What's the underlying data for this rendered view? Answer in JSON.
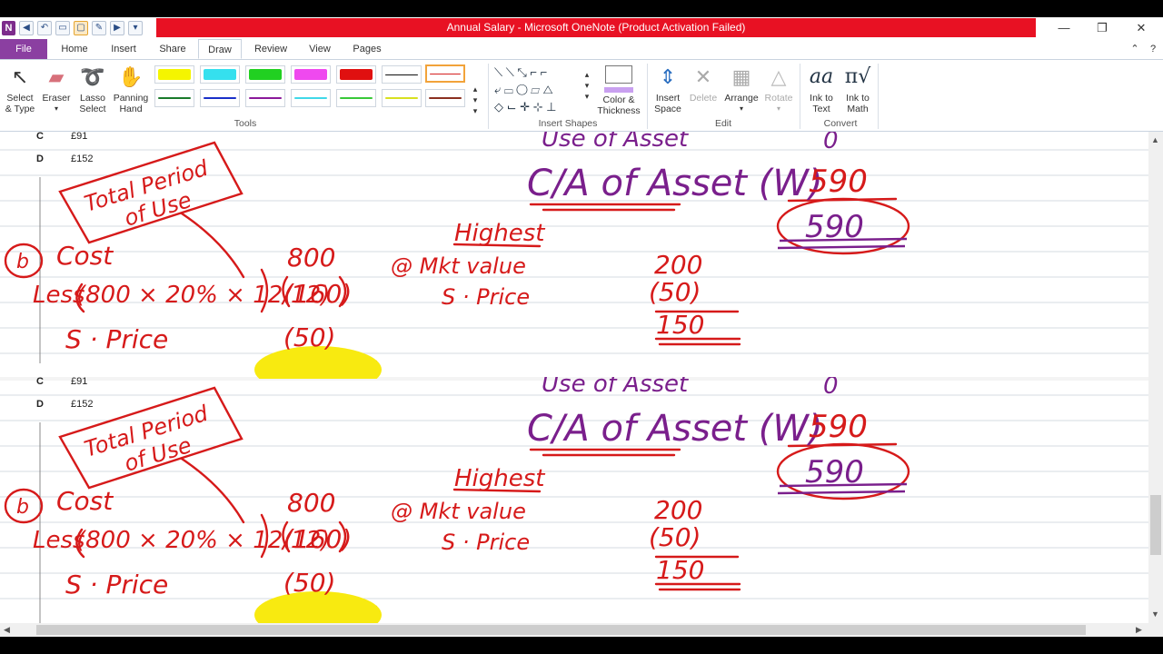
{
  "window": {
    "title": "Annual Salary - Microsoft OneNote (Product Activation Failed)",
    "app_icon": "N",
    "controls": [
      "minimize-icon",
      "restore-icon",
      "close-icon"
    ]
  },
  "tabs": [
    "File",
    "Home",
    "Insert",
    "Share",
    "Draw",
    "Review",
    "View",
    "Pages"
  ],
  "active_tab": "Draw",
  "ribbon": {
    "select_type": "Select\n& Type",
    "eraser": "Eraser",
    "lasso_select": "Lasso\nSelect",
    "panning_hand": "Panning\nHand",
    "tools_label": "Tools",
    "insert_shapes_label": "Insert Shapes",
    "color_thickness": "Color &\nThickness",
    "insert_space": "Insert\nSpace",
    "delete": "Delete",
    "arrange": "Arrange",
    "rotate": "Rotate",
    "edit_label": "Edit",
    "ink_to_text": "Ink to\nText",
    "ink_to_math": "Ink to\nMath",
    "convert_label": "Convert",
    "pen_colors": [
      "#f5f500",
      "#35e0ee",
      "#21d021",
      "#ef49ef",
      "#e01010",
      "#111111",
      "#d42020",
      "#1a7a2a",
      "#1a2fc8",
      "#8b1a9a",
      "#40d8e8",
      "#38c838",
      "#d8e020",
      "#8b3020"
    ]
  },
  "page": {
    "block1": {
      "opt_c": "C",
      "opt_c_val": "£91",
      "opt_d": "D",
      "opt_d_val": "£152"
    },
    "block2": {
      "opt_c": "C",
      "opt_c_val": "£91",
      "opt_d": "D",
      "opt_d_val": "£152"
    },
    "ink": {
      "total_period": "Total Period",
      "of_use": "of Use",
      "b": "b",
      "cost": "Cost",
      "less": "Less",
      "formula": "(800 × 20% × 12/12)",
      "s_price": "S · Price",
      "v800": "800",
      "v160": "(160)",
      "v50": "(50)",
      "highest": "Highest",
      "market_value": "@ Mkt value",
      "s_price2": "S · Price",
      "v200": "200",
      "v50b": "(50)",
      "v150": "150",
      "use_of_asset": "Use of Asset",
      "carrying_asset": "C/A of Asset (W)",
      "zero": "0",
      "v590": "590",
      "v590_circled": "590"
    }
  }
}
